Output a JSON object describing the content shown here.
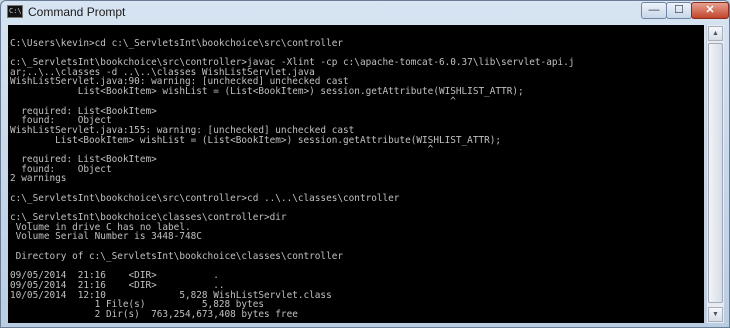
{
  "window": {
    "title": "Command Prompt",
    "icon_text": "C:\\",
    "buttons": {
      "minimize": "—",
      "maximize": "☐",
      "close": "✕"
    }
  },
  "console_lines": [
    "",
    "C:\\Users\\kevin>cd c:\\_ServletsInt\\bookchoice\\src\\controller",
    "",
    "c:\\_ServletsInt\\bookchoice\\src\\controller>javac -Xlint -cp c:\\apache-tomcat-6.0.37\\lib\\servlet-api.j",
    "ar;..\\..\\classes -d ..\\..\\classes WishListServlet.java",
    "WishListServlet.java:90: warning: [unchecked] unchecked cast",
    "            List<BookItem> wishList = (List<BookItem>) session.getAttribute(WISHLIST_ATTR);",
    "                                                                              ^",
    "  required: List<BookItem>",
    "  found:    Object",
    "WishListServlet.java:155: warning: [unchecked] unchecked cast",
    "        List<BookItem> wishList = (List<BookItem>) session.getAttribute(WISHLIST_ATTR);",
    "                                                                          ^",
    "  required: List<BookItem>",
    "  found:    Object",
    "2 warnings",
    "",
    "c:\\_ServletsInt\\bookchoice\\src\\controller>cd ..\\..\\classes\\controller",
    "",
    "c:\\_ServletsInt\\bookchoice\\classes\\controller>dir",
    " Volume in drive C has no label.",
    " Volume Serial Number is 3448-748C",
    "",
    " Directory of c:\\_ServletsInt\\bookchoice\\classes\\controller",
    "",
    "09/05/2014  21:16    <DIR>          .",
    "09/05/2014  21:16    <DIR>          ..",
    "10/05/2014  12:10             5,828 WishListServlet.class",
    "               1 File(s)          5,828 bytes",
    "               2 Dir(s)  763,254,673,408 bytes free",
    "",
    "c:\\_ServletsInt\\bookchoice\\classes\\controller>"
  ],
  "colors": {
    "console_bg": "#000000",
    "console_fg": "#c0c0c0",
    "titlebar": "#c9d9ea",
    "close_button": "#c2442b"
  },
  "icons": [
    "console-app-icon",
    "minimize-icon",
    "maximize-icon",
    "close-icon",
    "scroll-up-arrow-icon",
    "scroll-down-arrow-icon"
  ]
}
